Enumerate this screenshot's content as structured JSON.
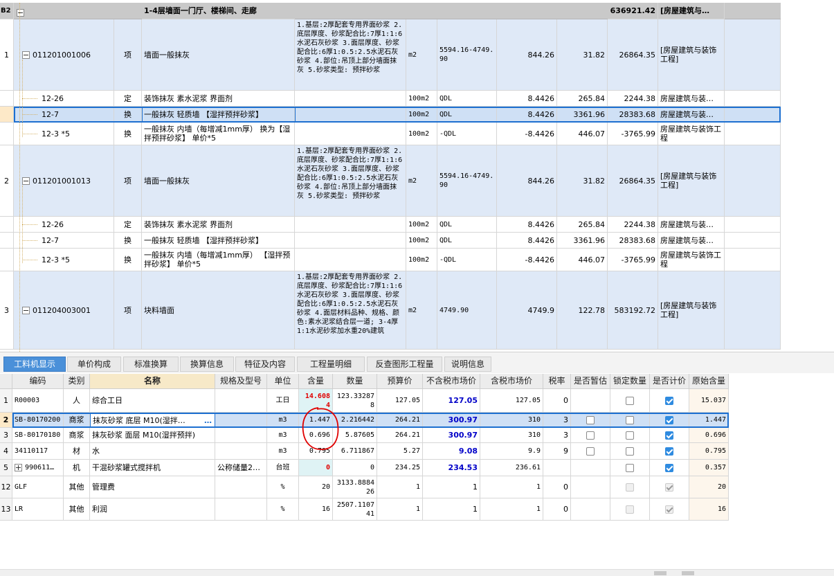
{
  "upper": {
    "header_row": {
      "id": "B2",
      "name": "1-4层墙面一门厅、楼梯间、走廊",
      "total": "636921.42",
      "category": "[房屋建筑与…"
    },
    "rows": [
      {
        "num": "1",
        "code": "011201001006",
        "type": "项",
        "name": "墙面一般抹灰",
        "features": "1.基层:2厚配套专用界面砂浆 2.底层厚度、砂浆配合比:7厚1:1:6水泥石灰砂浆 3.面层厚度、砂浆配合比:6厚1:0.5:2.5水泥石灰砂浆 4.部位:吊顶上部分墙面抹灰 5.砂浆类型: 预拌砂浆",
        "unit": "m2",
        "expr": "5594.16-4749.90",
        "qty": "844.26",
        "price": "31.82",
        "total": "26864.35",
        "category": "[房屋建筑与装饰工程]"
      },
      {
        "num": "",
        "code": "12-26",
        "type": "定",
        "name": "装饰抹灰 素水泥浆 界面剂",
        "features": "",
        "unit": "100m2",
        "expr": "QDL",
        "qty": "8.4426",
        "price": "265.84",
        "total": "2244.38",
        "category": "房屋建筑与装…"
      },
      {
        "num": "",
        "code": "12-7",
        "type": "换",
        "name": "一般抹灰 轻质墙 【湿拌预拌砂浆】",
        "features": "",
        "unit": "100m2",
        "expr": "QDL",
        "qty": "8.4426",
        "price": "3361.96",
        "total": "28383.68",
        "category": "房屋建筑与装…"
      },
      {
        "num": "",
        "code": "12-3 *5",
        "type": "换",
        "name": "一般抹灰 内墙（每增减1mm厚） 换为【湿拌预拌砂浆】 单价*5",
        "features": "",
        "unit": "100m2",
        "expr": "-QDL",
        "qty": "-8.4426",
        "price": "446.07",
        "total": "-3765.99",
        "category": "房屋建筑与装饰工程"
      },
      {
        "num": "2",
        "code": "011201001013",
        "type": "项",
        "name": "墙面一般抹灰",
        "features": "1.基层:2厚配套专用界面砂浆 2.底层厚度、砂浆配合比:7厚1:1:6水泥石灰砂浆 3.面层厚度、砂浆配合比:6厚1:0.5:2.5水泥石灰砂浆 4.部位:吊顶上部分墙面抹灰 5.砂浆类型: 预拌砂浆",
        "unit": "m2",
        "expr": "5594.16-4749.90",
        "qty": "844.26",
        "price": "31.82",
        "total": "26864.35",
        "category": "[房屋建筑与装饰工程]"
      },
      {
        "num": "",
        "code": "12-26",
        "type": "定",
        "name": "装饰抹灰 素水泥浆 界面剂",
        "features": "",
        "unit": "100m2",
        "expr": "QDL",
        "qty": "8.4426",
        "price": "265.84",
        "total": "2244.38",
        "category": "房屋建筑与装…"
      },
      {
        "num": "",
        "code": "12-7",
        "type": "换",
        "name": "一般抹灰 轻质墙 【湿拌预拌砂浆】",
        "features": "",
        "unit": "100m2",
        "expr": "QDL",
        "qty": "8.4426",
        "price": "3361.96",
        "total": "28383.68",
        "category": "房屋建筑与装…"
      },
      {
        "num": "",
        "code": "12-3 *5",
        "type": "换",
        "name": "一般抹灰 内墙（每增减1mm厚） 【湿拌预拌砂浆】 单价*5",
        "features": "",
        "unit": "100m2",
        "expr": "-QDL",
        "qty": "-8.4426",
        "price": "446.07",
        "total": "-3765.99",
        "category": "房屋建筑与装饰工程"
      },
      {
        "num": "3",
        "code": "011204003001",
        "type": "项",
        "name": "块料墙面",
        "features": "1.基层:2厚配套专用界面砂浆 2.底层厚度、砂浆配合比:7厚1:1:6水泥石灰砂浆 3.面层厚度、砂浆配合比:6厚1:0.5:2.5水泥石灰砂浆 4.面层材料品种、规格、颜色:素水泥浆结合层一道; 3-4厚1:1水泥砂浆加水重20%建筑",
        "unit": "m2",
        "expr": "4749.90",
        "qty": "4749.9",
        "price": "122.78",
        "total": "583192.72",
        "category": "[房屋建筑与装饰工程]"
      }
    ]
  },
  "tabs": [
    "工料机显示",
    "单价构成",
    "标准换算",
    "换算信息",
    "特征及内容",
    "工程量明细",
    "反查图形工程量",
    "说明信息"
  ],
  "lower": {
    "headers": [
      "编码",
      "类别",
      "名称",
      "规格及型号",
      "单位",
      "含量",
      "数量",
      "预算价",
      "不含税市场价",
      "含税市场价",
      "税率",
      "是否暂估",
      "锁定数量",
      "是否计价",
      "原始含量"
    ],
    "rows": [
      {
        "num": "1",
        "code": "R00003",
        "type": "人",
        "name": "综合工日",
        "spec": "",
        "unit": "工日",
        "content": "14.6084",
        "qty": "123.332878",
        "budget": "127.05",
        "mkt_ex": "127.05",
        "mkt_in": "127.05",
        "tax": "0",
        "orig": "15.037"
      },
      {
        "num": "2",
        "code": "SB-80170200",
        "type": "商浆",
        "name": "抹灰砂浆 底层 M10(湿拌…",
        "spec": "",
        "unit": "m3",
        "content": "1.447",
        "qty": "2.216442",
        "budget": "264.21",
        "mkt_ex": "300.97",
        "mkt_in": "310",
        "tax": "3",
        "orig": "1.447"
      },
      {
        "num": "3",
        "code": "SB-80170180",
        "type": "商浆",
        "name": "抹灰砂浆 面层 M10(湿拌预拌)",
        "spec": "",
        "unit": "m3",
        "content": "0.696",
        "qty": "5.87605",
        "budget": "264.21",
        "mkt_ex": "300.97",
        "mkt_in": "310",
        "tax": "3",
        "orig": "0.696"
      },
      {
        "num": "4",
        "code": "34110117",
        "type": "材",
        "name": "水",
        "spec": "",
        "unit": "m3",
        "content": "0.795",
        "qty": "6.711867",
        "budget": "5.27",
        "mkt_ex": "9.08",
        "mkt_in": "9.9",
        "tax": "9",
        "orig": "0.795"
      },
      {
        "num": "5",
        "code": "990611…",
        "type": "机",
        "name": "干混砂浆罐式搅拌机",
        "spec": "公称储量2…",
        "unit": "台班",
        "content": "0",
        "qty": "0",
        "budget": "234.25",
        "mkt_ex": "234.53",
        "mkt_in": "236.61",
        "tax": "",
        "orig": "0.357"
      },
      {
        "num": "12",
        "code": "GLF",
        "type": "其他",
        "name": "管理费",
        "spec": "",
        "unit": "%",
        "content": "20",
        "qty": "3133.888426",
        "budget": "1",
        "mkt_ex": "1",
        "mkt_in": "1",
        "tax": "0",
        "orig": "20"
      },
      {
        "num": "13",
        "code": "LR",
        "type": "其他",
        "name": "利润",
        "spec": "",
        "unit": "%",
        "content": "16",
        "qty": "2507.110741",
        "budget": "1",
        "mkt_ex": "1",
        "mkt_in": "1",
        "tax": "0",
        "orig": "16"
      }
    ]
  },
  "colors": {
    "selection": "#1c6fd0",
    "header_blue": "#dfe9f7",
    "annotation_red": "#e00000"
  }
}
